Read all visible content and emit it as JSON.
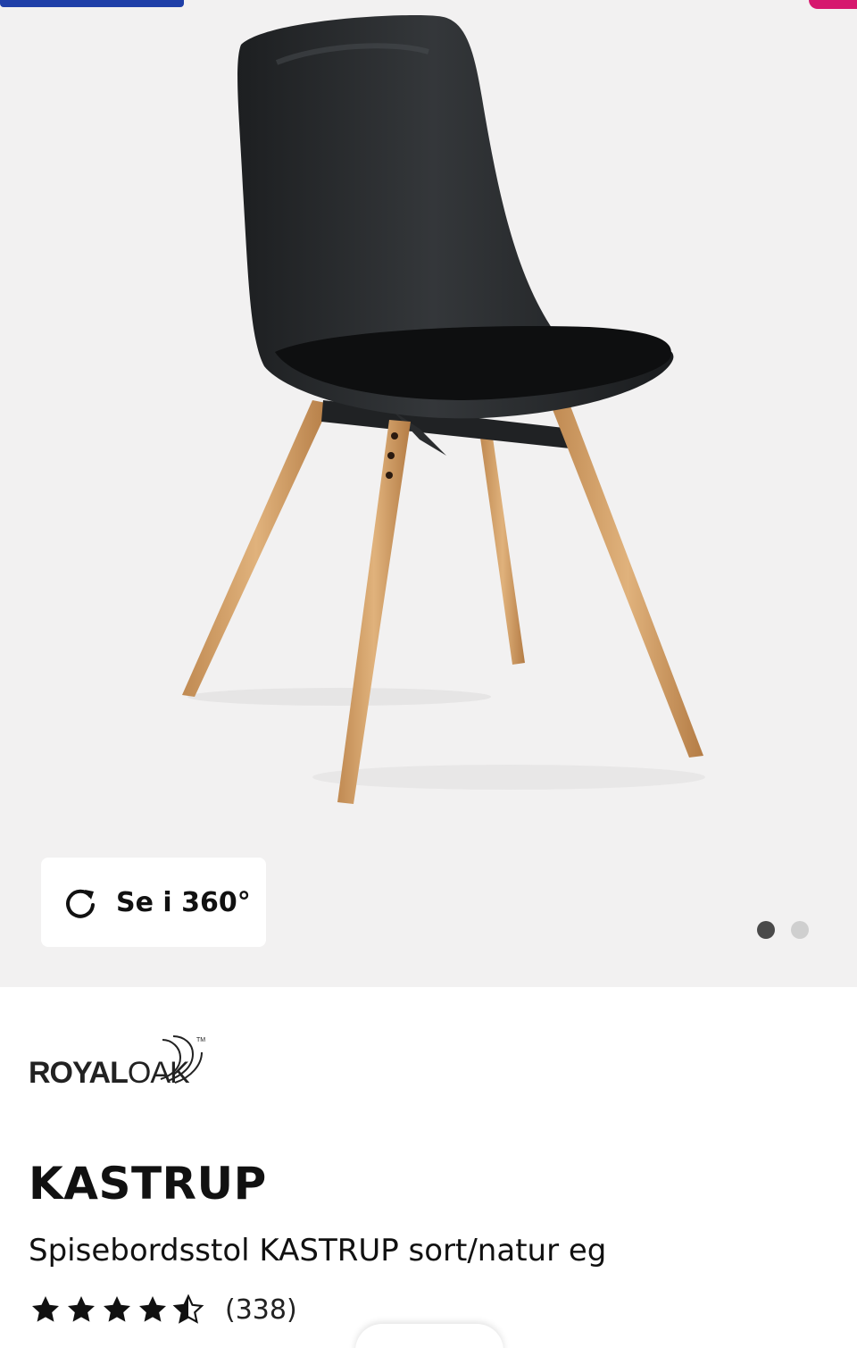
{
  "gallery": {
    "button_360_label": "Se i 360°",
    "button_360_icon": "rotate-icon",
    "slide_count": 2,
    "active_slide": 1,
    "colors": {
      "background": "#f2f1f1",
      "dot_active": "#4a4a4a",
      "dot_inactive": "#cfcfcf"
    }
  },
  "brand": {
    "name_bold": "ROYAL",
    "name_light": "OAK",
    "trademark": "TM"
  },
  "product": {
    "title": "KASTRUP",
    "subtitle": "Spisebordsstol KASTRUP sort/natur eg",
    "rating": 4.5,
    "rating_max": 5,
    "review_count": "(338)"
  },
  "accent_colors": {
    "blue": "#1f3fa8",
    "pink": "#d6186e"
  }
}
